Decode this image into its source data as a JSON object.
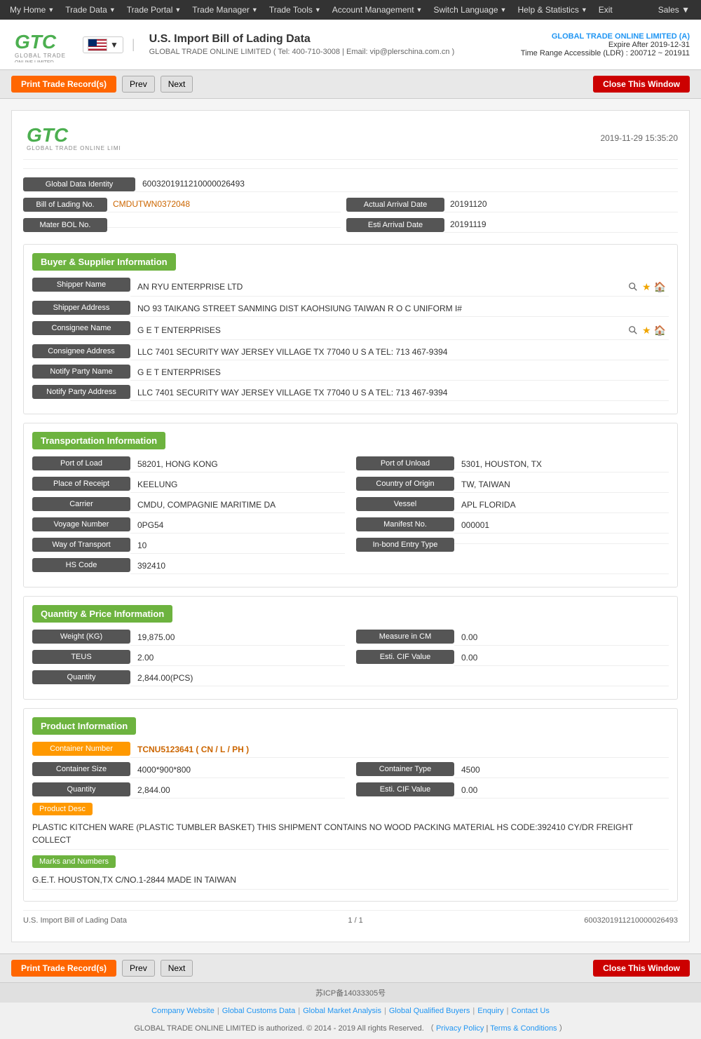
{
  "nav": {
    "items": [
      {
        "label": "My Home",
        "has_arrow": true
      },
      {
        "label": "Trade Data",
        "has_arrow": true
      },
      {
        "label": "Trade Portal",
        "has_arrow": true
      },
      {
        "label": "Trade Manager",
        "has_arrow": true
      },
      {
        "label": "Trade Tools",
        "has_arrow": true
      },
      {
        "label": "Account Management",
        "has_arrow": true
      },
      {
        "label": "Switch Language",
        "has_arrow": true
      },
      {
        "label": "Help & Statistics",
        "has_arrow": true
      },
      {
        "label": "Exit",
        "has_arrow": false
      }
    ],
    "right_label": "Sales"
  },
  "header": {
    "title": "U.S. Import Bill of Lading Data",
    "subtitle": "GLOBAL TRADE ONLINE LIMITED ( Tel: 400-710-3008 | Email: vip@plerschina.com.cn )",
    "company_name": "GLOBAL TRADE ONLINE LIMITED (A)",
    "expire": "Expire After 2019-12-31",
    "ldr": "Time Range Accessible (LDR) : 200712 ~ 201911"
  },
  "actions": {
    "print_label": "Print Trade Record(s)",
    "prev_label": "Prev",
    "next_label": "Next",
    "close_label": "Close This Window"
  },
  "record": {
    "datetime": "2019-11-29 15:35:20",
    "global_data_identity_label": "Global Data Identity",
    "global_data_identity_value": "6003201911210000026493",
    "bol_no_label": "Bill of Lading No.",
    "bol_no_value": "CMDUTWN0372048",
    "actual_arrival_label": "Actual Arrival Date",
    "actual_arrival_value": "20191120",
    "mater_bol_label": "Mater BOL No.",
    "mater_bol_value": "",
    "esti_arrival_label": "Esti Arrival Date",
    "esti_arrival_value": "20191119"
  },
  "buyer_supplier": {
    "section_title": "Buyer & Supplier Information",
    "shipper_name_label": "Shipper Name",
    "shipper_name_value": "AN RYU ENTERPRISE LTD",
    "shipper_address_label": "Shipper Address",
    "shipper_address_value": "NO 93 TAIKANG STREET SANMING DIST KAOHSIUNG TAIWAN R O C UNIFORM I#",
    "consignee_name_label": "Consignee Name",
    "consignee_name_value": "G E T ENTERPRISES",
    "consignee_address_label": "Consignee Address",
    "consignee_address_value": "LLC 7401 SECURITY WAY JERSEY VILLAGE TX 77040 U S A TEL: 713 467-9394",
    "notify_party_name_label": "Notify Party Name",
    "notify_party_name_value": "G E T ENTERPRISES",
    "notify_party_address_label": "Notify Party Address",
    "notify_party_address_value": "LLC 7401 SECURITY WAY JERSEY VILLAGE TX 77040 U S A TEL: 713 467-9394"
  },
  "transportation": {
    "section_title": "Transportation Information",
    "port_of_load_label": "Port of Load",
    "port_of_load_value": "58201, HONG KONG",
    "port_of_unload_label": "Port of Unload",
    "port_of_unload_value": "5301, HOUSTON, TX",
    "place_of_receipt_label": "Place of Receipt",
    "place_of_receipt_value": "KEELUNG",
    "country_of_origin_label": "Country of Origin",
    "country_of_origin_value": "TW, TAIWAN",
    "carrier_label": "Carrier",
    "carrier_value": "CMDU, COMPAGNIE MARITIME DA",
    "vessel_label": "Vessel",
    "vessel_value": "APL FLORIDA",
    "voyage_number_label": "Voyage Number",
    "voyage_number_value": "0PG54",
    "manifest_no_label": "Manifest No.",
    "manifest_no_value": "000001",
    "way_of_transport_label": "Way of Transport",
    "way_of_transport_value": "10",
    "in_bond_entry_type_label": "In-bond Entry Type",
    "in_bond_entry_type_value": "",
    "hs_code_label": "HS Code",
    "hs_code_value": "392410"
  },
  "quantity_price": {
    "section_title": "Quantity & Price Information",
    "weight_label": "Weight (KG)",
    "weight_value": "19,875.00",
    "measure_in_cm_label": "Measure in CM",
    "measure_in_cm_value": "0.00",
    "teus_label": "TEUS",
    "teus_value": "2.00",
    "esti_cif_label": "Esti. CIF Value",
    "esti_cif_value": "0.00",
    "quantity_label": "Quantity",
    "quantity_value": "2,844.00(PCS)"
  },
  "product": {
    "section_title": "Product Information",
    "container_number_label": "Container Number",
    "container_number_value": "TCNU5123641 ( CN / L / PH )",
    "container_size_label": "Container Size",
    "container_size_value": "4000*900*800",
    "container_type_label": "Container Type",
    "container_type_value": "4500",
    "quantity_label": "Quantity",
    "quantity_value": "2,844.00",
    "esti_cif_label": "Esti. CIF Value",
    "esti_cif_value": "0.00",
    "product_desc_label": "Product Desc",
    "product_desc_value": "PLASTIC KITCHEN WARE (PLASTIC TUMBLER BASKET) THIS SHIPMENT CONTAINS NO WOOD PACKING MATERIAL HS CODE:392410 CY/DR FREIGHT COLLECT",
    "marks_numbers_label": "Marks and Numbers",
    "marks_numbers_value": "G.E.T. HOUSTON,TX C/NO.1-2844 MADE IN TAIWAN"
  },
  "footer": {
    "record_label": "U.S. Import Bill of Lading Data",
    "page_info": "1 / 1",
    "record_id": "6003201911210000026493"
  },
  "site_footer": {
    "icp": "苏ICP备14033305号",
    "company_website": "Company Website",
    "global_customs": "Global Customs Data",
    "global_market": "Global Market Analysis",
    "global_qualified": "Global Qualified Buyers",
    "enquiry": "Enquiry",
    "contact_us": "Contact Us",
    "copyright": "GLOBAL TRADE ONLINE LIMITED is authorized. © 2014 - 2019 All rights Reserved.  （",
    "privacy_policy": "Privacy Policy",
    "sep": "|",
    "terms": "Terms & Conditions",
    "end": "）"
  }
}
